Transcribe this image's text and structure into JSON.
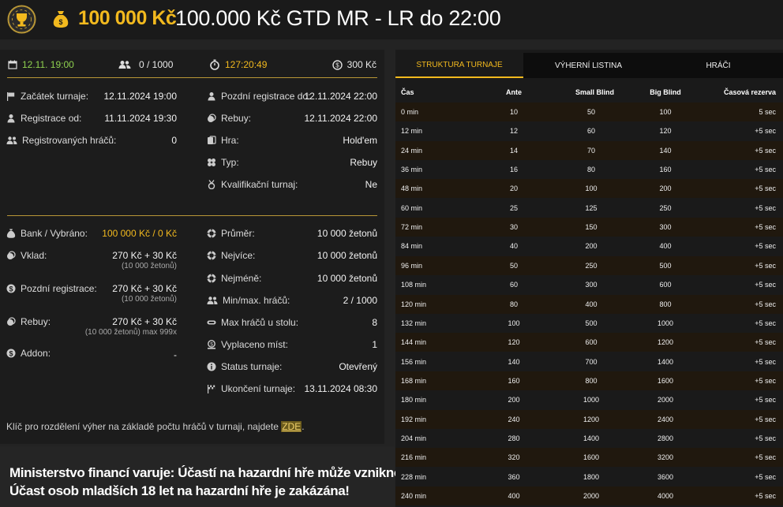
{
  "header": {
    "amount": "100 000 Kč",
    "title": "100.000 Kč GTD MR - LR do 22:00"
  },
  "strip": {
    "date": "12.11. 19:00",
    "players": "0 / 1000",
    "countdown": "127:20:49",
    "fee": "300 Kč"
  },
  "info_left": [
    {
      "label": "Začátek turnaje:",
      "value": "12.11.2024 19:00",
      "icon": "flag-icon"
    },
    {
      "label": "Registrace od:",
      "value": "11.11.2024 19:30",
      "icon": "user-icon"
    },
    {
      "label": "Registrovaných hráčů:",
      "value": "0",
      "icon": "users-icon"
    }
  ],
  "info_right": [
    {
      "label": "Pozdní registrace do:",
      "value": "12.11.2024 22:00",
      "icon": "user-icon"
    },
    {
      "label": "Rebuy:",
      "value": "12.11.2024 22:00",
      "icon": "coins-icon"
    },
    {
      "label": "Hra:",
      "value": "Hold'em",
      "icon": "cards-icon"
    },
    {
      "label": "Typ:",
      "value": "Rebuy",
      "icon": "chips-icon"
    },
    {
      "label": "Kvalifikační turnaj:",
      "value": "Ne",
      "icon": "medal-icon"
    }
  ],
  "money_left": [
    {
      "label": "Bank / Vybráno:",
      "value": "100 000 Kč / 0 Kč",
      "sub": "",
      "icon": "moneybag-icon"
    },
    {
      "label": "Vklad:",
      "value": "270 Kč + 30 Kč",
      "sub": "(10 000 žetonů)",
      "icon": "coins-icon"
    },
    {
      "label": "Pozdní registrace:",
      "value": "270 Kč + 30 Kč",
      "sub": "(10 000 žetonů)",
      "icon": "dollar-icon"
    },
    {
      "label": "Rebuy:",
      "value": "270 Kč + 30 Kč",
      "sub": "(10 000 žetonů) max 999x",
      "icon": "coins-icon"
    },
    {
      "label": "Addon:",
      "value": "-",
      "sub": "",
      "icon": "dollar-icon"
    }
  ],
  "money_right": [
    {
      "label": "Průměr:",
      "value": "10 000 žetonů",
      "icon": "chip-icon"
    },
    {
      "label": "Nejvíce:",
      "value": "10 000 žetonů",
      "icon": "chip-icon"
    },
    {
      "label": "Nejméně:",
      "value": "10 000 žetonů",
      "icon": "chip-icon"
    },
    {
      "label": "Min/max. hráčů:",
      "value": "2 / 1000",
      "icon": "users-icon"
    },
    {
      "label": "Max hráčů u stolu:",
      "value": "8",
      "icon": "table-icon"
    },
    {
      "label": "Vyplaceno míst:",
      "value": "1",
      "icon": "payout-icon"
    },
    {
      "label": "Status turnaje:",
      "value": "Otevřený",
      "icon": "info-icon"
    },
    {
      "label": "Ukončení turnaje:",
      "value": "13.11.2024 08:30",
      "icon": "flag-icon"
    }
  ],
  "key_note": {
    "text": "Klíč pro rozdělení výher na základě počtu hráčů v turnaji, najdete ",
    "link": "ZDE",
    "suffix": "."
  },
  "warning": {
    "line1": "Ministerstvo financí varuje: Účastí na hazardní hře může vzniknout závislost!",
    "line2": "Účast osob mladších 18 let na hazardní hře je zakázána!"
  },
  "tabs": [
    "STRUKTURA TURNAJE",
    "VÝHERNÍ LISTINA",
    "HRÁČI"
  ],
  "table": {
    "headers": [
      "Čas",
      "Ante",
      "Small Blind",
      "Big Blind",
      "Časová rezerva"
    ],
    "rows": [
      [
        "0 min",
        "10",
        "50",
        "100",
        "5 sec"
      ],
      [
        "12 min",
        "12",
        "60",
        "120",
        "+5 sec"
      ],
      [
        "24 min",
        "14",
        "70",
        "140",
        "+5 sec"
      ],
      [
        "36 min",
        "16",
        "80",
        "160",
        "+5 sec"
      ],
      [
        "48 min",
        "20",
        "100",
        "200",
        "+5 sec"
      ],
      [
        "60 min",
        "25",
        "125",
        "250",
        "+5 sec"
      ],
      [
        "72 min",
        "30",
        "150",
        "300",
        "+5 sec"
      ],
      [
        "84 min",
        "40",
        "200",
        "400",
        "+5 sec"
      ],
      [
        "96 min",
        "50",
        "250",
        "500",
        "+5 sec"
      ],
      [
        "108 min",
        "60",
        "300",
        "600",
        "+5 sec"
      ],
      [
        "120 min",
        "80",
        "400",
        "800",
        "+5 sec"
      ],
      [
        "132 min",
        "100",
        "500",
        "1000",
        "+5 sec"
      ],
      [
        "144 min",
        "120",
        "600",
        "1200",
        "+5 sec"
      ],
      [
        "156 min",
        "140",
        "700",
        "1400",
        "+5 sec"
      ],
      [
        "168 min",
        "160",
        "800",
        "1600",
        "+5 sec"
      ],
      [
        "180 min",
        "200",
        "1000",
        "2000",
        "+5 sec"
      ],
      [
        "192 min",
        "240",
        "1200",
        "2400",
        "+5 sec"
      ],
      [
        "204 min",
        "280",
        "1400",
        "2800",
        "+5 sec"
      ],
      [
        "216 min",
        "320",
        "1600",
        "3200",
        "+5 sec"
      ],
      [
        "228 min",
        "360",
        "1800",
        "3600",
        "+5 sec"
      ],
      [
        "240 min",
        "400",
        "2000",
        "4000",
        "+5 sec"
      ]
    ]
  }
}
